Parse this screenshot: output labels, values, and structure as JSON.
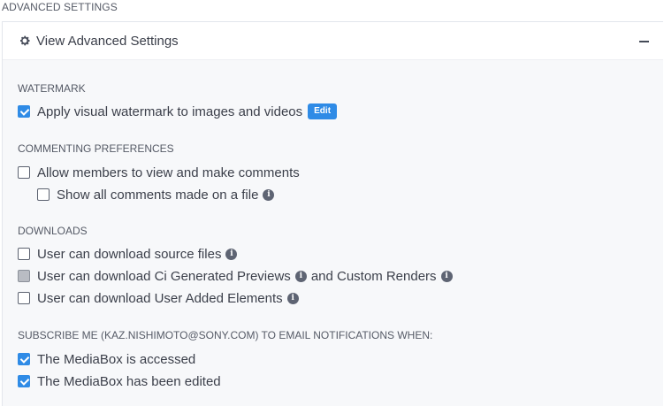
{
  "section_title": "ADVANCED SETTINGS",
  "panel": {
    "title": "View Advanced Settings"
  },
  "watermark": {
    "label": "WATERMARK",
    "apply": {
      "label": "Apply visual watermark to images and videos",
      "checked": true
    },
    "edit_label": "Edit"
  },
  "commenting": {
    "label": "COMMENTING PREFERENCES",
    "allow": {
      "label": "Allow members to view and make comments",
      "checked": false
    },
    "show_all": {
      "label": "Show all comments made on a file",
      "checked": false
    }
  },
  "downloads": {
    "label": "DOWNLOADS",
    "source": {
      "label": "User can download source files",
      "checked": false
    },
    "previews": {
      "label_a": "User can download Ci Generated Previews",
      "label_b": "and Custom Renders",
      "state": "indeterminate"
    },
    "elements": {
      "label": "User can download User Added Elements",
      "checked": false
    }
  },
  "subscribe": {
    "label": "SUBSCRIBE ME (KAZ.NISHIMOTO@SONY.COM) TO EMAIL NOTIFICATIONS WHEN:",
    "accessed": {
      "label": "The MediaBox is accessed",
      "checked": true
    },
    "edited": {
      "label": "The MediaBox has been edited",
      "checked": true
    }
  },
  "colors": {
    "accent": "#2f8be6",
    "text": "#3b3f4a",
    "panel_bg": "#f7f8fa"
  },
  "icons": {
    "header": "gear-icon",
    "info": "info-icon",
    "collapse": "minus-icon"
  }
}
